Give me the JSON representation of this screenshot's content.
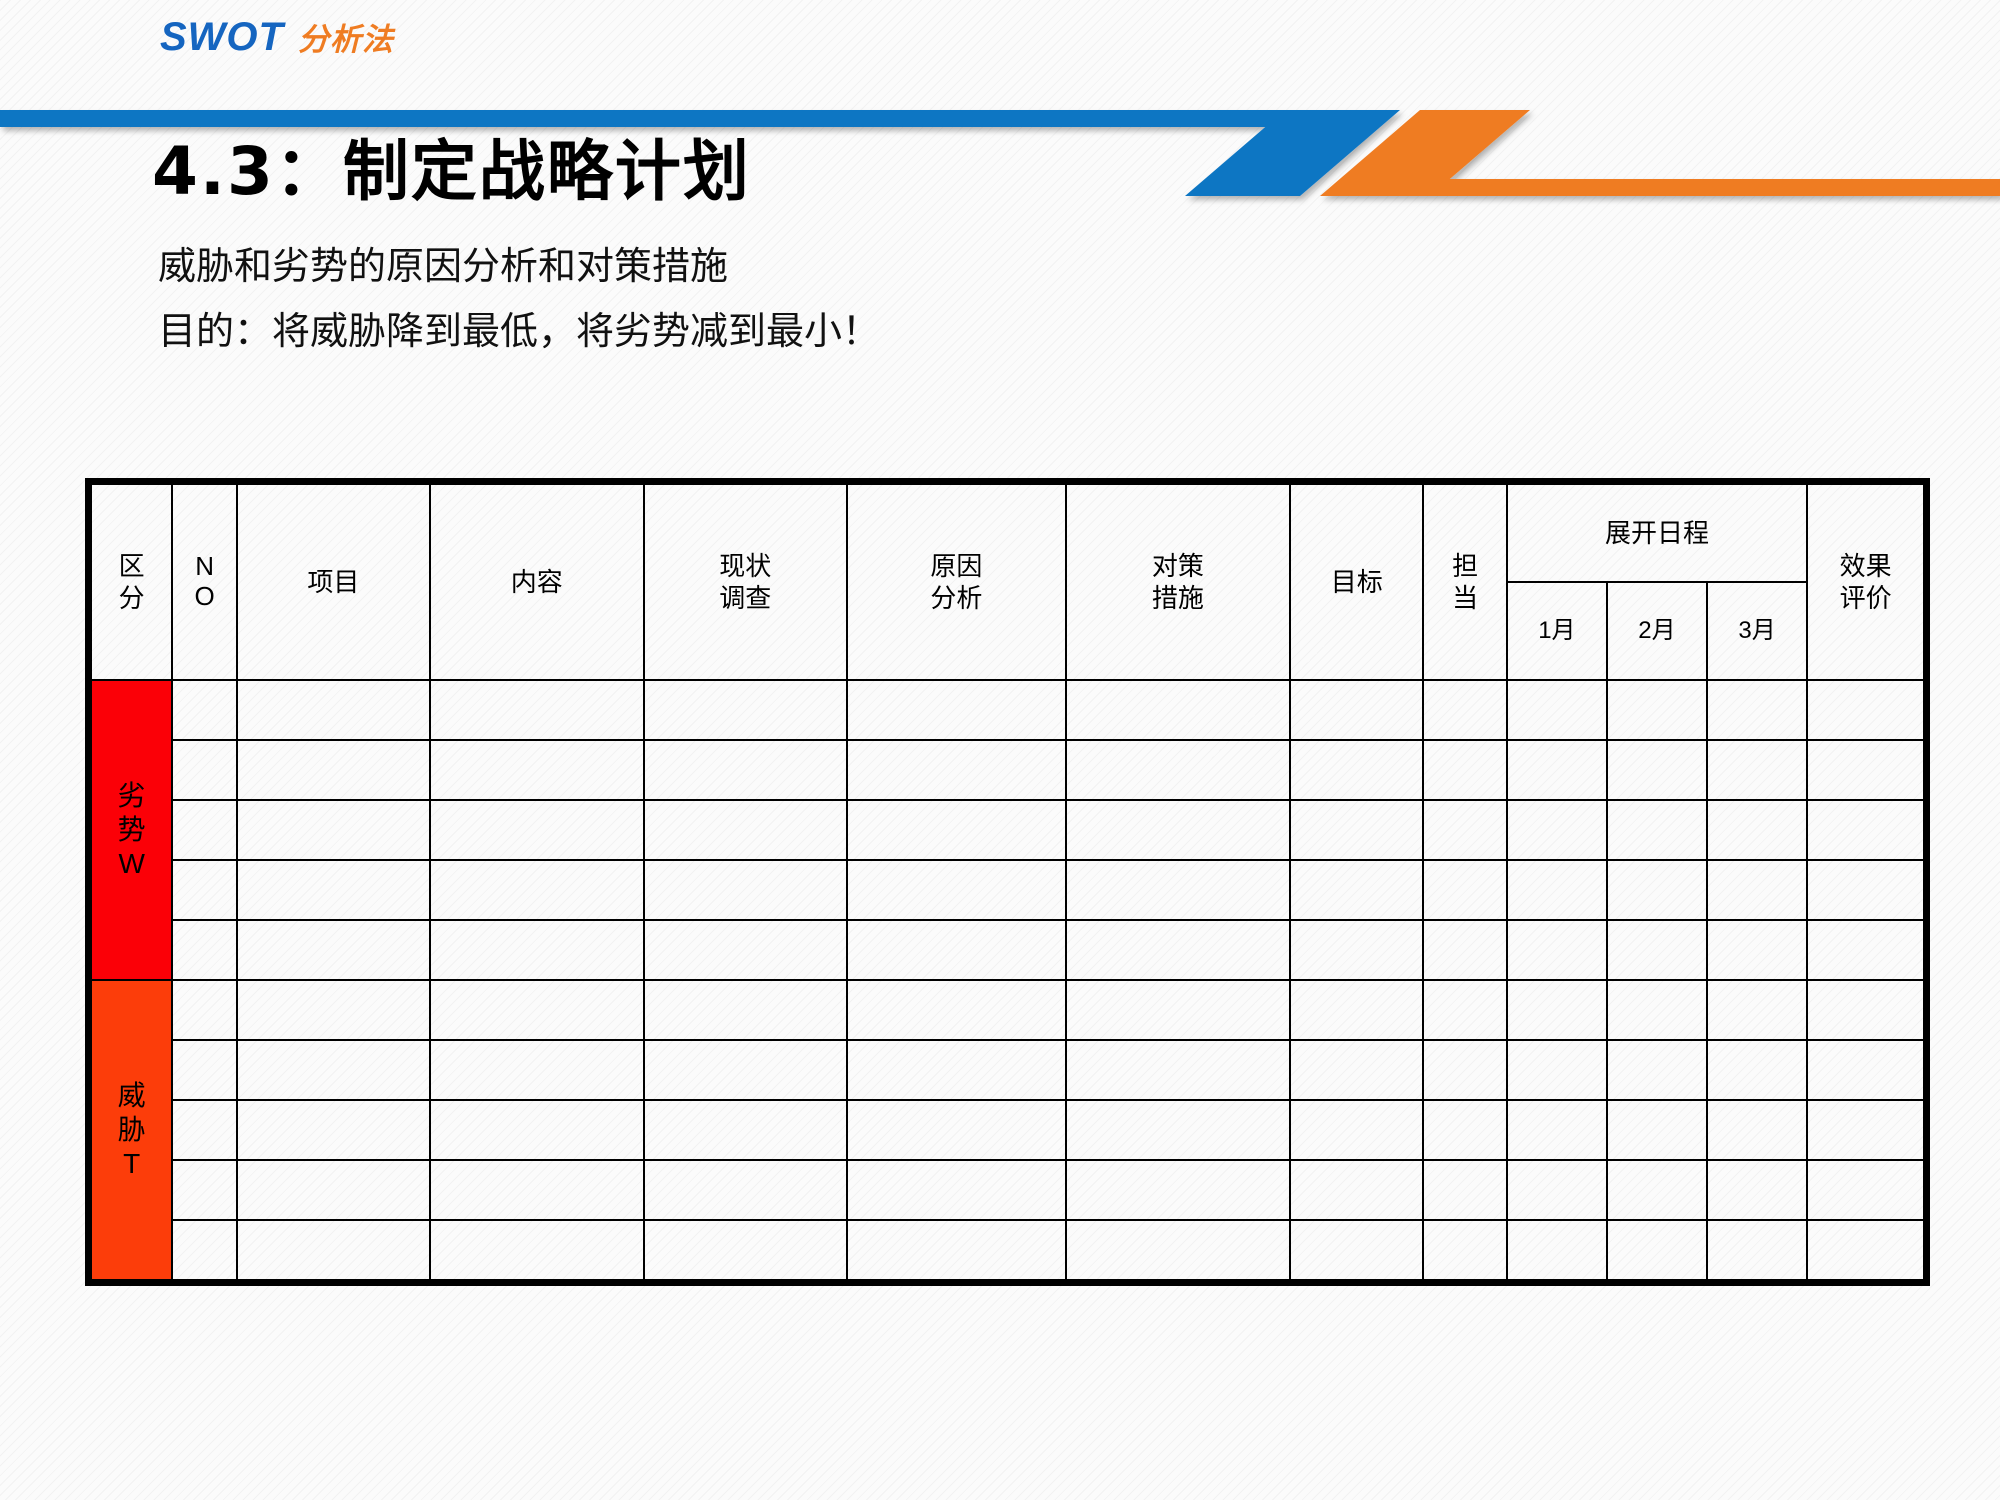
{
  "logo": {
    "brand": "SWOT",
    "suffix": "分析法",
    "brand_color": "#1565c0",
    "suffix_color": "#ef7c22"
  },
  "decoration": {
    "blue_color": "#0f76c3",
    "orange_color": "#ef7c22"
  },
  "title": {
    "number": "4.3",
    "separator": "：",
    "text": "制定战略计划",
    "full": "4.3：制定战略计划"
  },
  "subtitles": {
    "line1": "威胁和劣势的原因分析和对策措施",
    "line2": "目的：将威胁降到最低，将劣势减到最小！"
  },
  "table": {
    "headers": {
      "category_l1": "区",
      "category_l2": "分",
      "no_l1": "N",
      "no_l2": "O",
      "item": "项目",
      "content": "内容",
      "status_l1": "现状",
      "status_l2": "调查",
      "cause_l1": "原因",
      "cause_l2": "分析",
      "measure_l1": "对策",
      "measure_l2": "措施",
      "goal": "目标",
      "owner_l1": "担",
      "owner_l2": "当",
      "schedule": "展开日程",
      "month1": "1月",
      "month2": "2月",
      "month3": "3月",
      "effect_l1": "效果",
      "effect_l2": "评价"
    },
    "sections": [
      {
        "id": "weakness",
        "label_lines": [
          "劣",
          "势",
          "W"
        ],
        "color": "#fb0007",
        "row_count": 5,
        "rows": [
          {
            "no": "",
            "item": "",
            "content": "",
            "status": "",
            "cause": "",
            "measure": "",
            "goal": "",
            "owner": "",
            "m1": "",
            "m2": "",
            "m3": "",
            "effect": ""
          },
          {
            "no": "",
            "item": "",
            "content": "",
            "status": "",
            "cause": "",
            "measure": "",
            "goal": "",
            "owner": "",
            "m1": "",
            "m2": "",
            "m3": "",
            "effect": ""
          },
          {
            "no": "",
            "item": "",
            "content": "",
            "status": "",
            "cause": "",
            "measure": "",
            "goal": "",
            "owner": "",
            "m1": "",
            "m2": "",
            "m3": "",
            "effect": ""
          },
          {
            "no": "",
            "item": "",
            "content": "",
            "status": "",
            "cause": "",
            "measure": "",
            "goal": "",
            "owner": "",
            "m1": "",
            "m2": "",
            "m3": "",
            "effect": ""
          },
          {
            "no": "",
            "item": "",
            "content": "",
            "status": "",
            "cause": "",
            "measure": "",
            "goal": "",
            "owner": "",
            "m1": "",
            "m2": "",
            "m3": "",
            "effect": ""
          }
        ]
      },
      {
        "id": "threat",
        "label_lines": [
          "威",
          "胁",
          "T"
        ],
        "color": "#fc3d0a",
        "row_count": 5,
        "rows": [
          {
            "no": "",
            "item": "",
            "content": "",
            "status": "",
            "cause": "",
            "measure": "",
            "goal": "",
            "owner": "",
            "m1": "",
            "m2": "",
            "m3": "",
            "effect": ""
          },
          {
            "no": "",
            "item": "",
            "content": "",
            "status": "",
            "cause": "",
            "measure": "",
            "goal": "",
            "owner": "",
            "m1": "",
            "m2": "",
            "m3": "",
            "effect": ""
          },
          {
            "no": "",
            "item": "",
            "content": "",
            "status": "",
            "cause": "",
            "measure": "",
            "goal": "",
            "owner": "",
            "m1": "",
            "m2": "",
            "m3": "",
            "effect": ""
          },
          {
            "no": "",
            "item": "",
            "content": "",
            "status": "",
            "cause": "",
            "measure": "",
            "goal": "",
            "owner": "",
            "m1": "",
            "m2": "",
            "m3": "",
            "effect": ""
          },
          {
            "no": "",
            "item": "",
            "content": "",
            "status": "",
            "cause": "",
            "measure": "",
            "goal": "",
            "owner": "",
            "m1": "",
            "m2": "",
            "m3": "",
            "effect": ""
          }
        ]
      }
    ]
  }
}
